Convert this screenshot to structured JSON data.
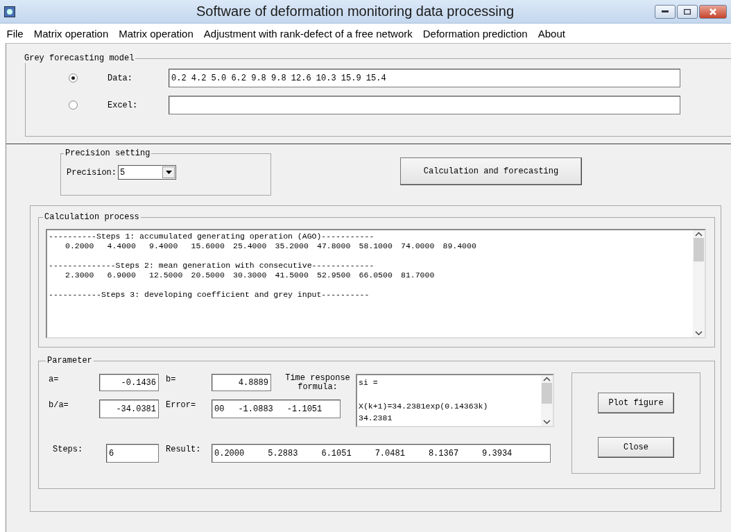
{
  "window": {
    "title": "Software of deformation monitoring data processing"
  },
  "menu": [
    "File",
    "Matrix operation",
    "Matrix operation",
    "Adjustment with rank-defect of a free network",
    "Deformation prediction",
    "About"
  ],
  "grey_model": {
    "title": "Grey forecasting model",
    "sources": [
      {
        "label": "Data:",
        "selected": true,
        "value": "0.2 4.2 5.0 6.2 9.8 9.8 12.6 10.3 15.9 15.4"
      },
      {
        "label": "Excel:",
        "selected": false
      }
    ]
  },
  "precision": {
    "title": "Precision setting",
    "label": "Precision:",
    "value": "5"
  },
  "calculate_button": "Calculation and forecasting",
  "process": {
    "title": "Calculation process",
    "steps": [
      {
        "heading": "----------Steps 1: accumulated generating operation (AGO)-----------",
        "values": [
          "0.2000",
          "4.4000",
          "9.4000",
          "15.6000",
          "25.4000",
          "35.2000",
          "47.8000",
          "58.1000",
          "74.0000",
          "89.4000"
        ]
      },
      {
        "heading": "--------------Steps 2: mean generation with consecutive-------------",
        "values": [
          "2.3000",
          "6.9000",
          "12.5000",
          "20.5000",
          "30.3000",
          "41.5000",
          "52.9500",
          "66.0500",
          "81.7000"
        ]
      },
      {
        "heading": "-----------Steps 3: developing coefficient and grey input----------"
      }
    ]
  },
  "parameter": {
    "title": "Parameter",
    "a": {
      "label": "a=",
      "value": "-0.1436"
    },
    "b": {
      "label": "b=",
      "value": "4.8889"
    },
    "b_over_a": {
      "label": "b/a=",
      "value": "-34.0381"
    },
    "error": {
      "label": "Error=",
      "values": [
        "00",
        "-1.0883",
        "-1.1051"
      ]
    },
    "steps": {
      "label": "Steps:",
      "value": "6"
    },
    "result": {
      "label": "Result:",
      "values": [
        "0.2000",
        "5.2883",
        "6.1051",
        "7.0481",
        "8.1367",
        "9.3934"
      ]
    },
    "formula": {
      "label": "Time response formula:",
      "name": "si =",
      "expression": "X(k+1)=34.2381exp(0.14363k)",
      "value": "34.2381"
    },
    "buttons": [
      "Plot figure",
      "Close"
    ]
  }
}
